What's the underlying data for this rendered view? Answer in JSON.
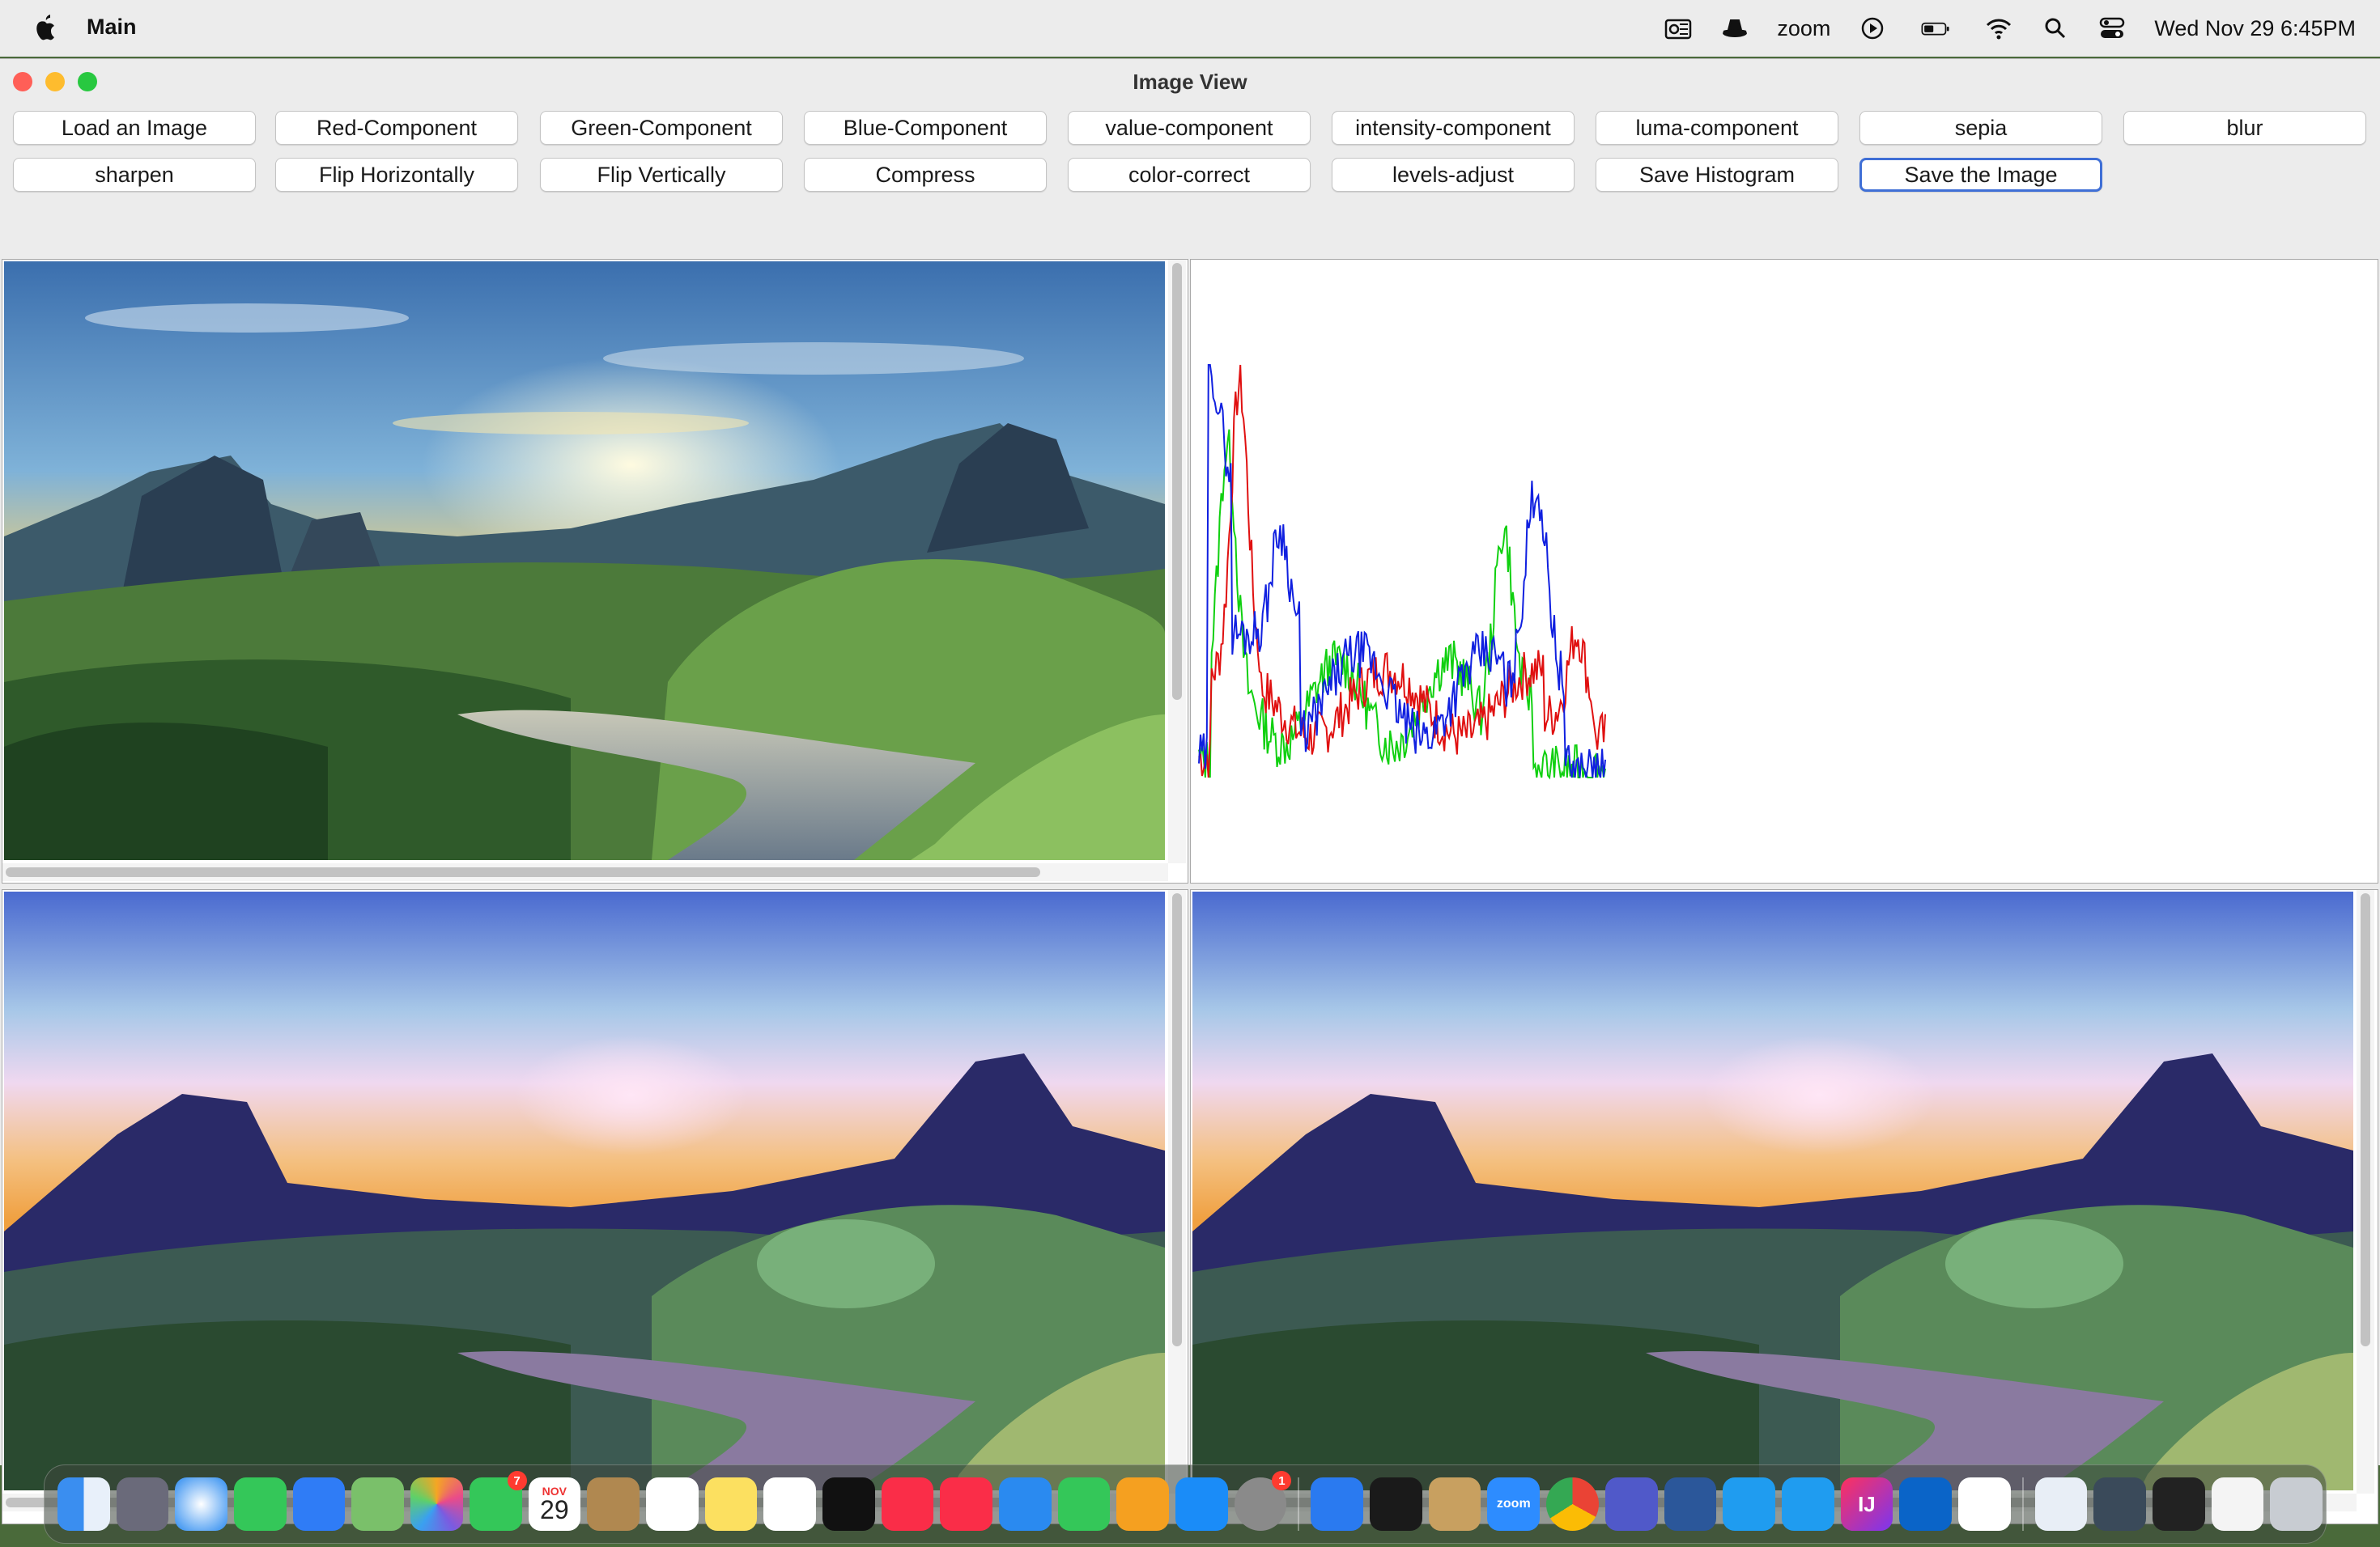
{
  "menubar": {
    "app_name": "Main",
    "zoom_label": "zoom",
    "datetime": "Wed Nov 29  6:45PM",
    "icons": [
      "outlook-icon",
      "incognito-icon",
      "zoom-icon",
      "play-icon",
      "battery-icon",
      "wifi-icon",
      "search-icon",
      "control-center-icon"
    ]
  },
  "window": {
    "title": "Image View",
    "buttons_row1": [
      "Load an Image",
      "Red-Component",
      "Green-Component",
      "Blue-Component",
      "value-component",
      "intensity-component",
      "luma-component",
      "sepia",
      "blur"
    ],
    "buttons_row2": [
      "sharpen",
      "Flip Horizontally",
      "Flip Vertically",
      "Compress",
      "color-correct",
      "levels-adjust",
      "Save Histogram",
      "Save the Image"
    ],
    "focused_button": "Save the Image"
  },
  "panes": {
    "original": "original-image",
    "histogram": "histogram",
    "preview_left": "compressed-preview",
    "preview_right": "compressed-preview-copy"
  },
  "histogram": {
    "series_colors": {
      "red": "#e01010",
      "green": "#10d010",
      "blue": "#1020e0"
    }
  },
  "dock": {
    "calendar_month": "NOV",
    "calendar_day": "29",
    "facetime_badge": "7",
    "settings_badge": "1",
    "zoom_text": "zoom",
    "intellij_text": "IJ",
    "apps": [
      "finder",
      "launchpad",
      "safari",
      "messages",
      "mail",
      "maps",
      "photos",
      "facetime",
      "calendar",
      "contacts",
      "reminders",
      "notes",
      "freeform",
      "apple-tv",
      "music",
      "news",
      "keynote",
      "numbers",
      "pages",
      "app-store",
      "system-settings",
      "bluetooth",
      "terminal",
      "paintbrush",
      "zoom",
      "chrome",
      "teams",
      "word",
      "vscode",
      "vscode-insiders",
      "intellij",
      "outlook",
      "java",
      "preview",
      "screenshot",
      "desktop",
      "downloads",
      "trash"
    ]
  }
}
